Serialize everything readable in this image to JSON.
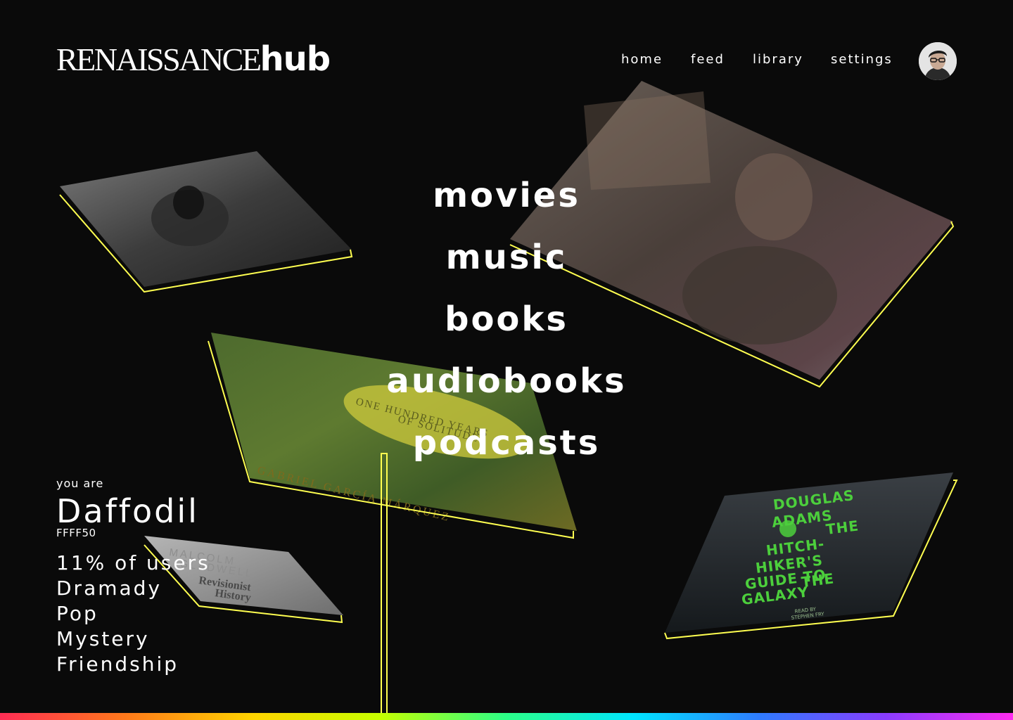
{
  "brand": {
    "logo_serif": "RENAISSANCE",
    "logo_bold": "hub"
  },
  "nav": {
    "items": [
      "home",
      "feed",
      "library",
      "settings"
    ]
  },
  "user": {
    "avatar_icon": "user-avatar"
  },
  "categories": [
    "movies",
    "music",
    "books",
    "audiobooks",
    "podcasts"
  ],
  "profile": {
    "intro": "you are",
    "color_name": "Daffodil",
    "color_hex": "FFFF50",
    "stats": [
      "11% of users",
      "Dramady",
      "Pop",
      "Mystery",
      "Friendship"
    ]
  },
  "cover_art": {
    "book_cover_text": [
      "ONE HUNDRED YEARS",
      "OF SOLITUDE",
      "GABRIEL GARCÍA MÁRQUEZ"
    ],
    "podcast_cover_text": [
      "MALCOLM",
      "GLADWELL",
      "Revisionist",
      "History"
    ],
    "audiobook_cover_text": [
      "DOUGLAS",
      "ADAMS",
      "THE",
      "HITCH-",
      "HIKER'S",
      "GUIDE TO",
      "THE",
      "GALAXY",
      "READ BY",
      "STEPHEN FRY"
    ]
  },
  "colors": {
    "background": "#0a0a0a",
    "accent": "#FFFF50",
    "text": "#ffffff"
  }
}
